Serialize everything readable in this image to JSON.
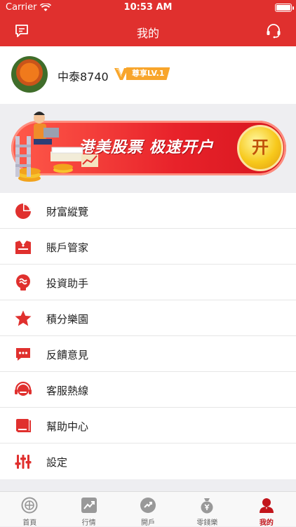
{
  "status_bar": {
    "carrier": "Carrier",
    "time": "10:53 AM"
  },
  "nav": {
    "title": "我的",
    "left_icon": "message-icon",
    "right_icon": "headset-icon"
  },
  "profile": {
    "username": "中泰8740",
    "vip_level": "尊享LV.1"
  },
  "banner": {
    "text": "港美股票 极速开户",
    "button": "开"
  },
  "menu": [
    {
      "label": "財富縱覽",
      "icon": "pie-chart-icon"
    },
    {
      "label": "賬戶管家",
      "icon": "butler-icon"
    },
    {
      "label": "投資助手",
      "icon": "bulb-icon"
    },
    {
      "label": "積分樂園",
      "icon": "star-icon"
    },
    {
      "label": "反饋意見",
      "icon": "chat-icon"
    },
    {
      "label": "客服熱線",
      "icon": "headset-icon"
    },
    {
      "label": "幫助中心",
      "icon": "book-icon"
    },
    {
      "label": "設定",
      "icon": "sliders-icon"
    }
  ],
  "tabs": [
    {
      "label": "首頁",
      "icon": "home-icon",
      "active": false
    },
    {
      "label": "行情",
      "icon": "trend-icon",
      "active": false
    },
    {
      "label": "開戶",
      "icon": "open-account-icon",
      "active": false
    },
    {
      "label": "零錢樂",
      "icon": "money-bag-icon",
      "active": false
    },
    {
      "label": "我的",
      "icon": "user-icon",
      "active": true
    }
  ],
  "colors": {
    "brand": "#e0302e",
    "accent": "#c2151b",
    "vip": "#f8a52b"
  }
}
